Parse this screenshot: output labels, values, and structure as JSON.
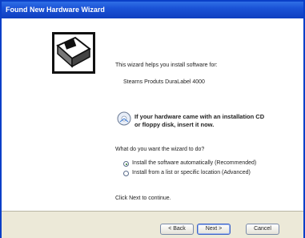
{
  "window": {
    "title": "Found New Hardware Wizard"
  },
  "intro": {
    "line1": "This wizard helps you install software for:",
    "device": "Stearns Produts DuraLabel 4000"
  },
  "cd_prompt": {
    "line1": "If your hardware came with an installation CD",
    "line2": "or floppy disk, insert it now."
  },
  "question": "What do you want the wizard to do?",
  "options": [
    {
      "label": "Install the software automatically (Recommended)",
      "selected": true
    },
    {
      "label": "Install from a list or specific location (Advanced)",
      "selected": false
    }
  ],
  "continue_text": "Click Next to continue.",
  "buttons": {
    "back": "< Back",
    "next": "Next >",
    "cancel": "Cancel"
  }
}
